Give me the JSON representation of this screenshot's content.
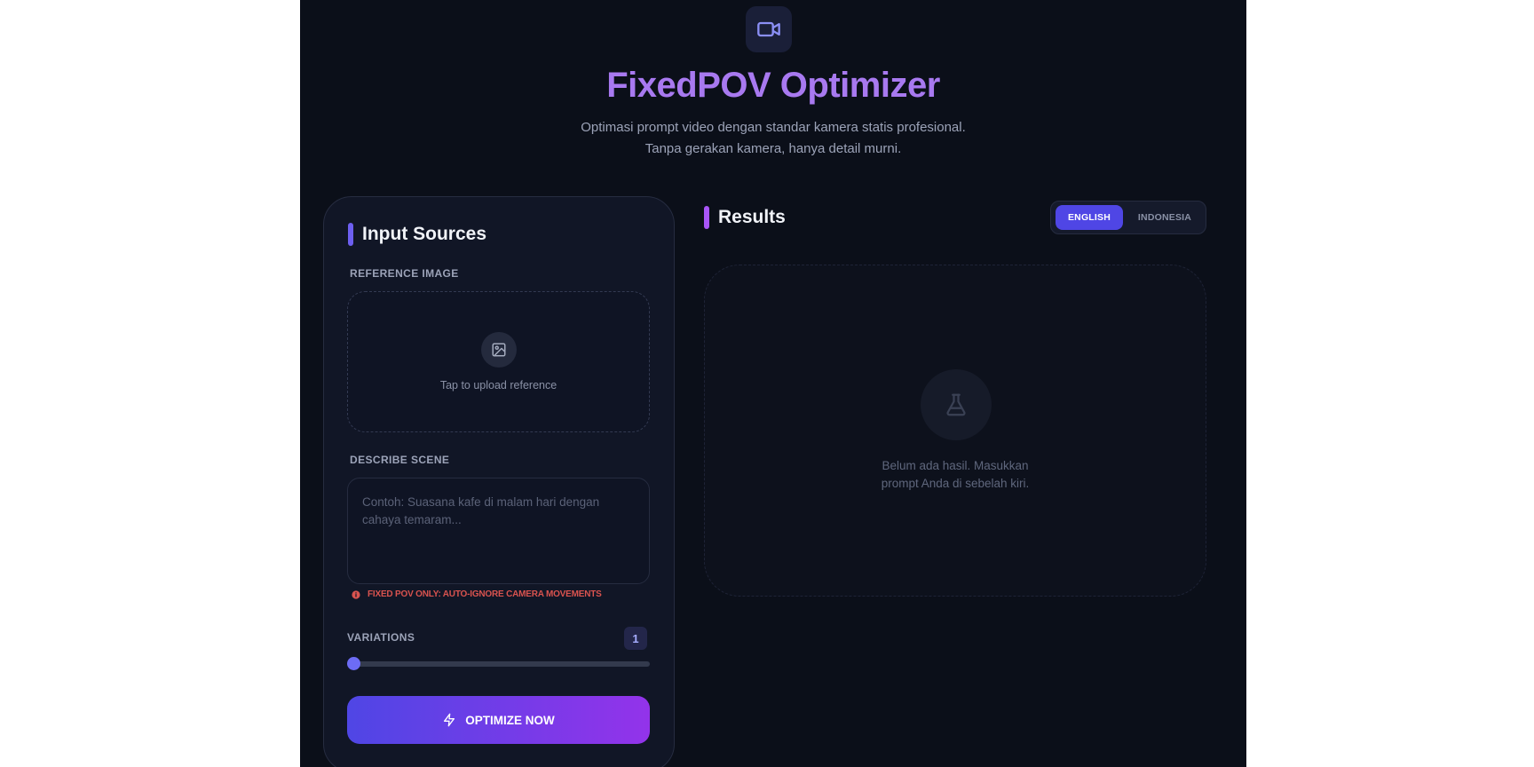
{
  "header": {
    "logo_icon": "video-camera-icon",
    "title": "FixedPOV Optimizer",
    "subtitle_line1": "Optimasi prompt video dengan standar kamera statis profesional.",
    "subtitle_line2": "Tanpa gerakan kamera, hanya detail murni."
  },
  "input_panel": {
    "title": "Input Sources",
    "reference_label": "REFERENCE IMAGE",
    "upload_icon": "image-icon",
    "upload_text": "Tap to upload reference",
    "scene_label": "DESCRIBE SCENE",
    "scene_value": "",
    "scene_placeholder": "Contoh: Suasana kafe di malam hari dengan cahaya temaram...",
    "warning_icon": "info-icon",
    "warning_text": "FIXED POV ONLY: AUTO-IGNORE CAMERA MOVEMENTS",
    "variations_label": "VARIATIONS",
    "variations_value": "1",
    "variations_slider_fraction": 0,
    "optimize_icon": "lightning-icon",
    "optimize_label": "OPTIMIZE NOW"
  },
  "results_panel": {
    "title": "Results",
    "languages": [
      "ENGLISH",
      "INDONESIA"
    ],
    "selected_language": "ENGLISH",
    "empty_icon": "flask-icon",
    "empty_line1": "Belum ada hasil. Masukkan",
    "empty_line2": "prompt Anda di sebelah kiri."
  },
  "colors": {
    "background": "#0b0f19",
    "panel": "#111626",
    "accent_indigo": "#4f46e5",
    "accent_purple": "#9333ea",
    "title": "#a879f0",
    "warning": "#d9534f"
  }
}
